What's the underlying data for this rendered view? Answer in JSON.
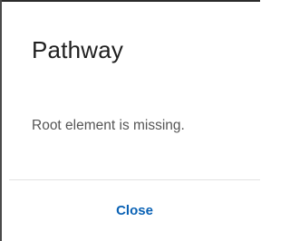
{
  "dialog": {
    "title": "Pathway",
    "message": "Root element is missing.",
    "close_label": "Close"
  },
  "colors": {
    "title_text": "#1f1f1f",
    "message_text": "#555555",
    "accent": "#0a62b5",
    "divider": "#e2e2e2",
    "background": "#ffffff"
  }
}
